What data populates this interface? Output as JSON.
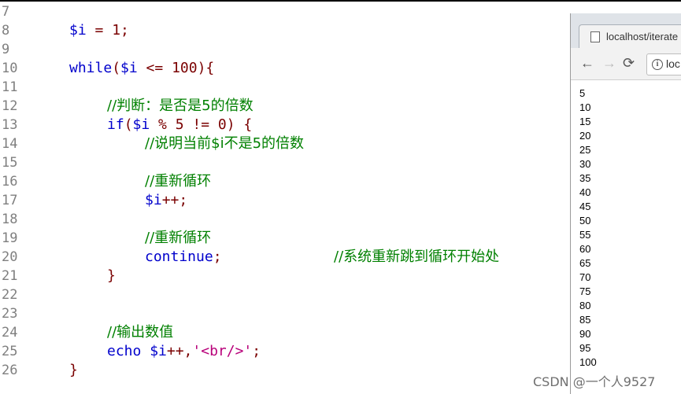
{
  "editor": {
    "line_numbers": [
      "7",
      "8",
      "9",
      "10",
      "11",
      "12",
      "13",
      "14",
      "15",
      "16",
      "17",
      "18",
      "19",
      "20",
      "21",
      "22",
      "23",
      "24",
      "25",
      "26"
    ],
    "l8_var": "$i",
    "l8_rest": " = 1;",
    "l10_kw": "while",
    "l10_open": "(",
    "l10_var": "$i",
    "l10_rest": " <= 100){",
    "l12_comment": "//判断：是否是5的倍数",
    "l13_kw": "if",
    "l13_open": "(",
    "l13_var": "$i",
    "l13_rest": " % 5 != 0) {",
    "l14_comment": "//说明当前$i不是5的倍数",
    "l16_comment": "//重新循环",
    "l17_var": "$i",
    "l17_rest": "++;",
    "l19_comment": "//重新循环",
    "l20_kw": "continue",
    "l20_semi": ";",
    "l20_comment": "//系统重新跳到循环开始处",
    "l21_brace": "}",
    "l24_comment": "//输出数值",
    "l25_kw": "echo",
    "l25_var": " $i",
    "l25_op": "++,",
    "l25_str": "'<br/>'",
    "l25_semi": ";",
    "l26_brace": "}"
  },
  "browser": {
    "tab_title": "localhost/iterate",
    "address": "loc",
    "info_glyph": "i",
    "back_glyph": "←",
    "forward_glyph": "→",
    "reload_glyph": "⟳",
    "output": [
      "5",
      "10",
      "15",
      "20",
      "25",
      "30",
      "35",
      "40",
      "45",
      "50",
      "55",
      "60",
      "65",
      "70",
      "75",
      "80",
      "85",
      "90",
      "95",
      "100"
    ]
  },
  "watermark": "CSDN @一个人9527"
}
